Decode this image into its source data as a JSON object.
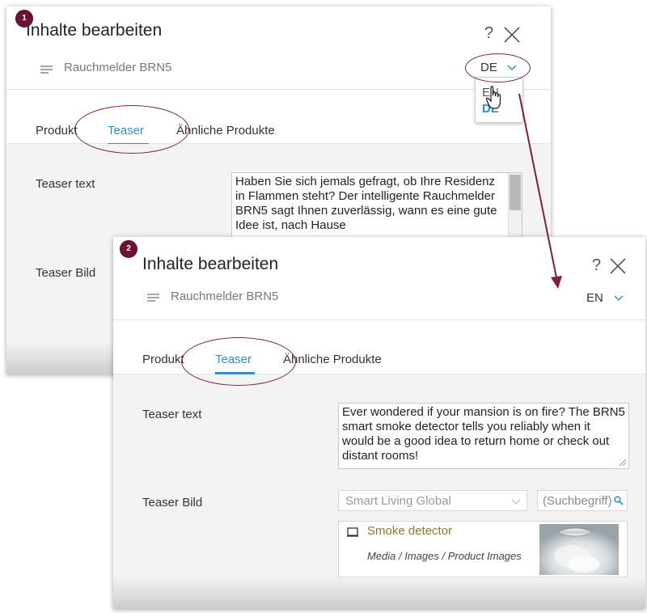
{
  "dialog1": {
    "step": "1",
    "title": "Inhalte bearbeiten",
    "help": "?",
    "product_name": "Rauchmelder BRN5",
    "language": "DE",
    "tabs": [
      {
        "label": "Produkt"
      },
      {
        "label": "Teaser"
      },
      {
        "label": "Ähnliche Produkte"
      }
    ],
    "teaser_text_label": "Teaser text",
    "teaser_text_value": "Haben Sie sich jemals gefragt, ob Ihre Residenz in Flammen steht? Der intelligente Rauchmelder BRN5 sagt Ihnen zuverlässig, wann es eine gute Idee ist, nach Hause",
    "teaser_image_label": "Teaser Bild",
    "language_options": [
      "EN",
      "DE"
    ]
  },
  "dialog2": {
    "step": "2",
    "title": "Inhalte bearbeiten",
    "help": "?",
    "product_name": "Rauchmelder BRN5",
    "language": "EN",
    "tabs": [
      {
        "label": "Produkt"
      },
      {
        "label": "Teaser"
      },
      {
        "label": "Ähnliche Produkte"
      }
    ],
    "teaser_text_label": "Teaser text",
    "teaser_text_value": "Ever wondered if your mansion is on fire? The BRN5 smart smoke detector tells you reliably when it would be a good idea to return home or check out distant rooms!",
    "teaser_image_label": "Teaser Bild",
    "site_select": "Smart Living Global",
    "search_placeholder": "(Suchbegriff)",
    "image_card": {
      "title": "Smoke detector",
      "path": "Media / Images / Product Images"
    }
  },
  "colors": {
    "accent": "#2e8fd0",
    "annotation": "#7b1f45",
    "badge": "#6d1234",
    "card_title": "#8a7a2a"
  }
}
